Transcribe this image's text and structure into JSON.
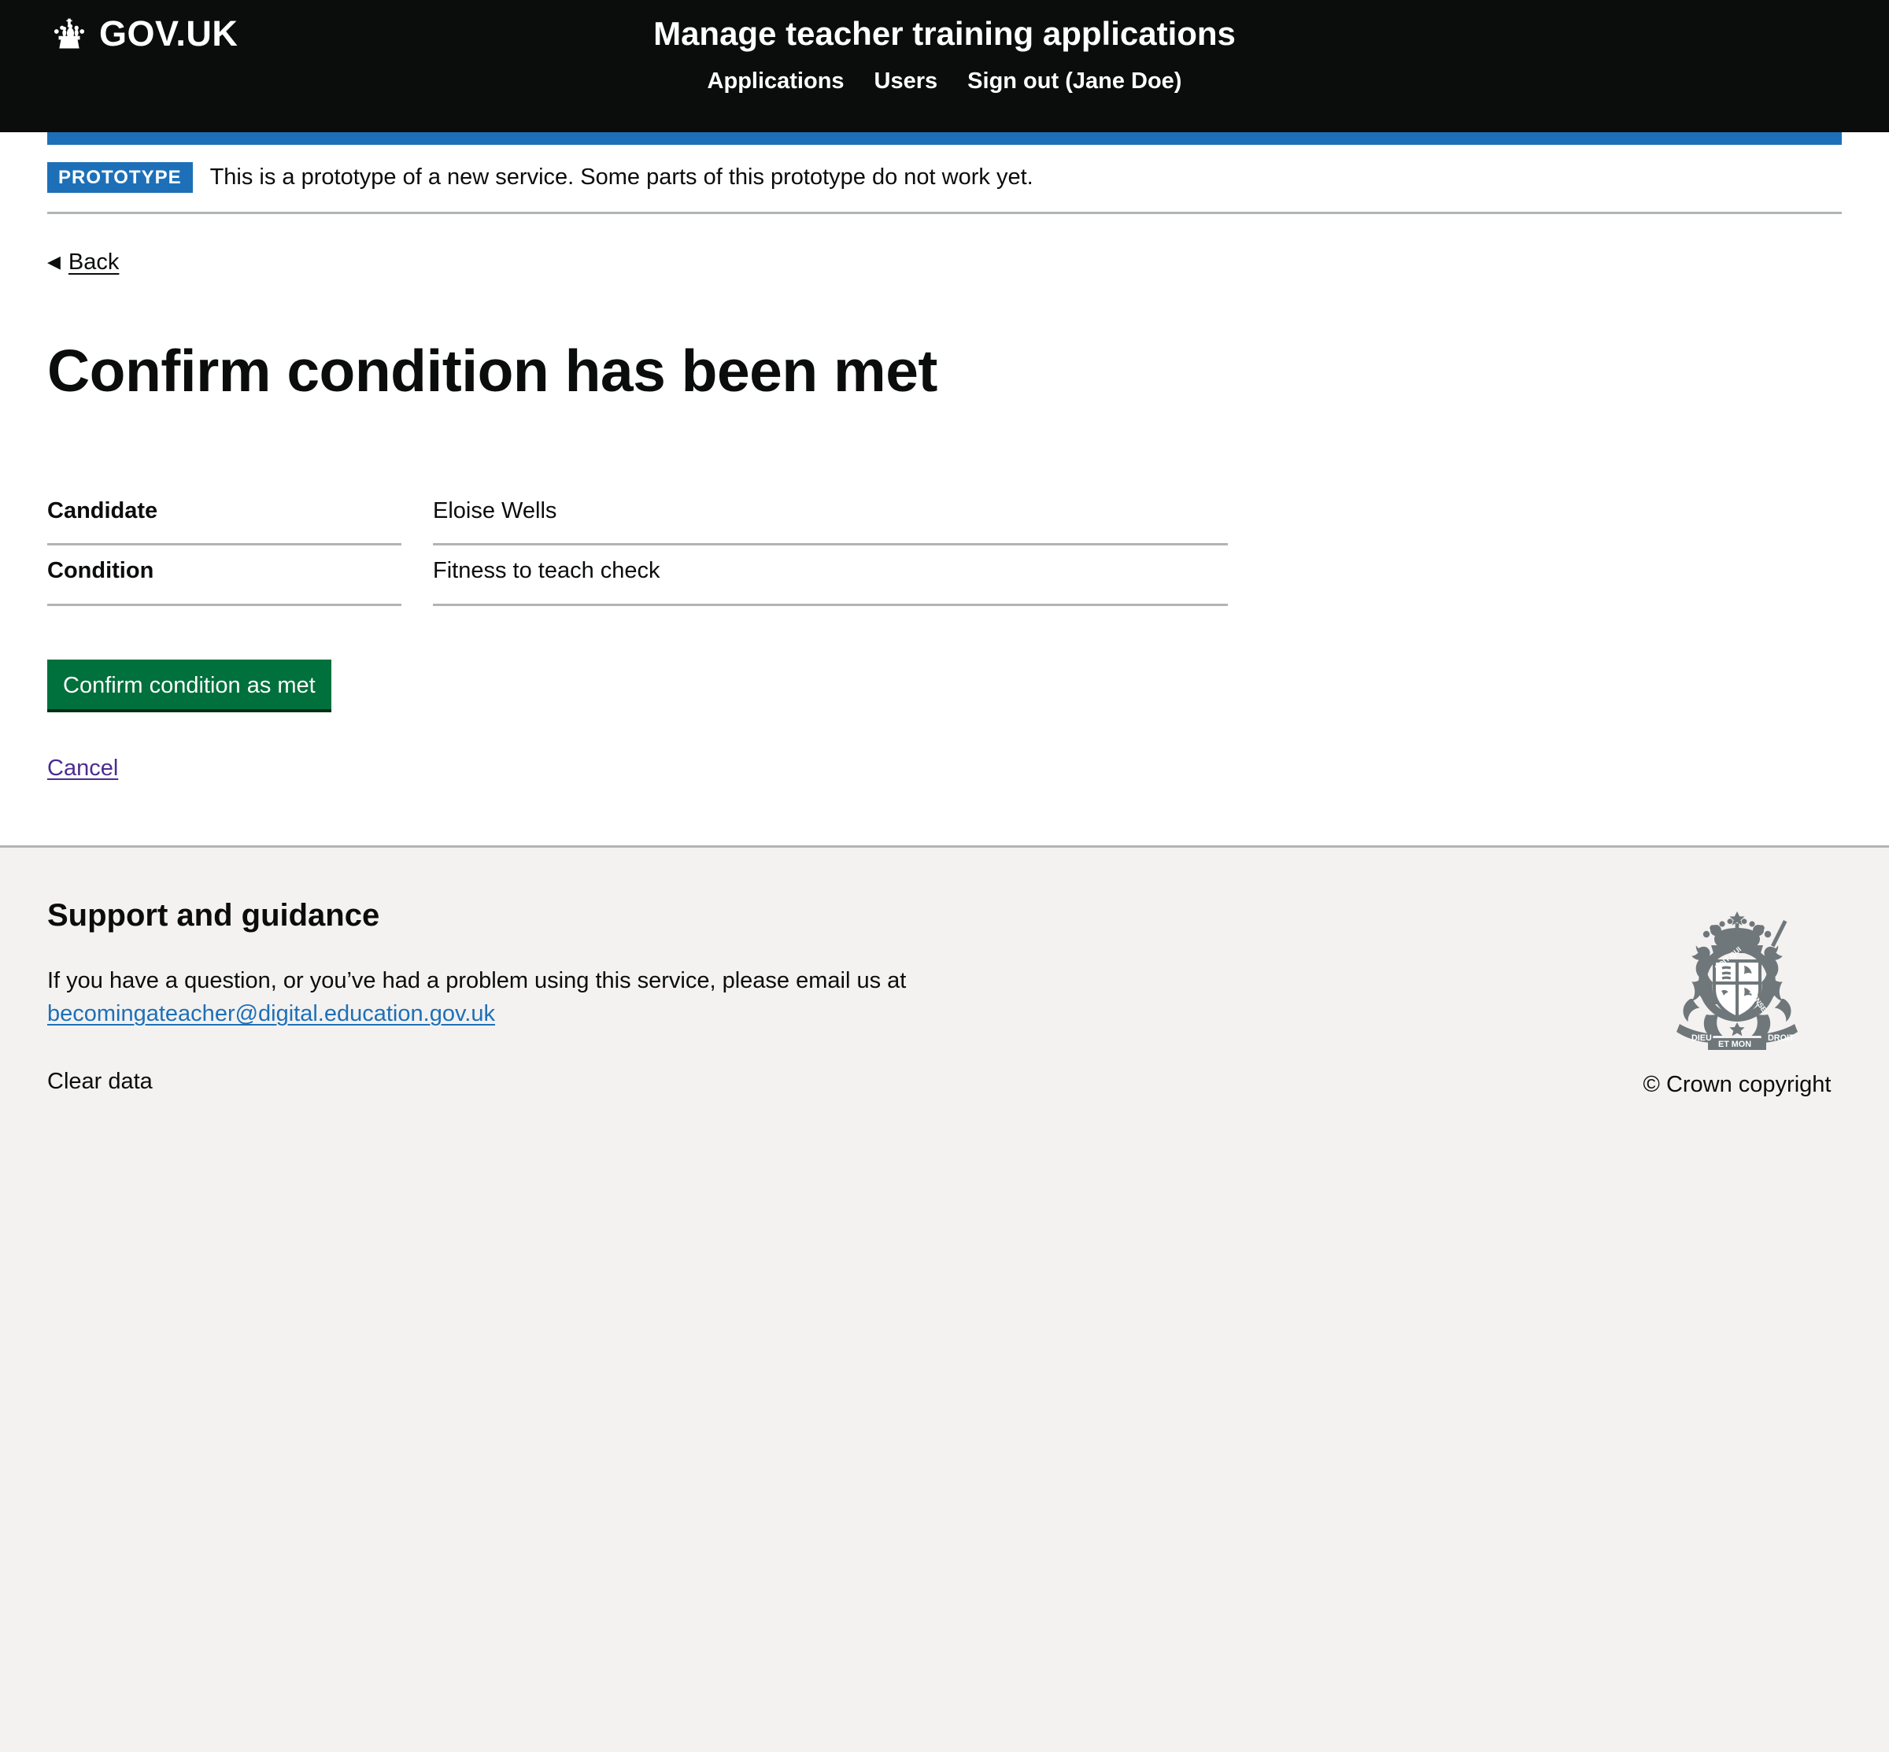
{
  "header": {
    "logo_text": "GOV.UK",
    "logo_icon": "crown-icon",
    "service_name": "Manage teacher training applications",
    "nav": [
      {
        "label": "Applications"
      },
      {
        "label": "Users"
      },
      {
        "label": "Sign out (Jane Doe)"
      }
    ]
  },
  "phase_banner": {
    "tag": "PROTOTYPE",
    "text": "This is a prototype of a new service. Some parts of this prototype do not work yet."
  },
  "back_link": {
    "label": "Back",
    "arrow_icon": "chevron-left-icon"
  },
  "main": {
    "heading": "Confirm condition has been met",
    "summary_rows": [
      {
        "key": "Candidate",
        "value": "Eloise Wells"
      },
      {
        "key": "Condition",
        "value": "Fitness to teach check"
      }
    ],
    "confirm_button_label": "Confirm condition as met",
    "cancel_label": "Cancel"
  },
  "footer": {
    "heading": "Support and guidance",
    "text_before_link": "If you have a question, or you’ve had a problem using this service, please email us at",
    "email": "becomingateacher@digital.education.gov.uk",
    "clear_data_label": "Clear data",
    "crest_icon": "royal-coat-of-arms-icon",
    "copyright": "© Crown copyright"
  },
  "colors": {
    "header_background": "#0b0c0c",
    "govuk_blue": "#1d70b8",
    "button_green": "#00703c",
    "button_shadow": "#002d18",
    "link_visited_purple": "#4c2c92",
    "border_grey": "#b1b4b6",
    "footer_background": "#f3f2f1",
    "crest_grey": "#6f777b",
    "text_black": "#0b0c0c"
  }
}
